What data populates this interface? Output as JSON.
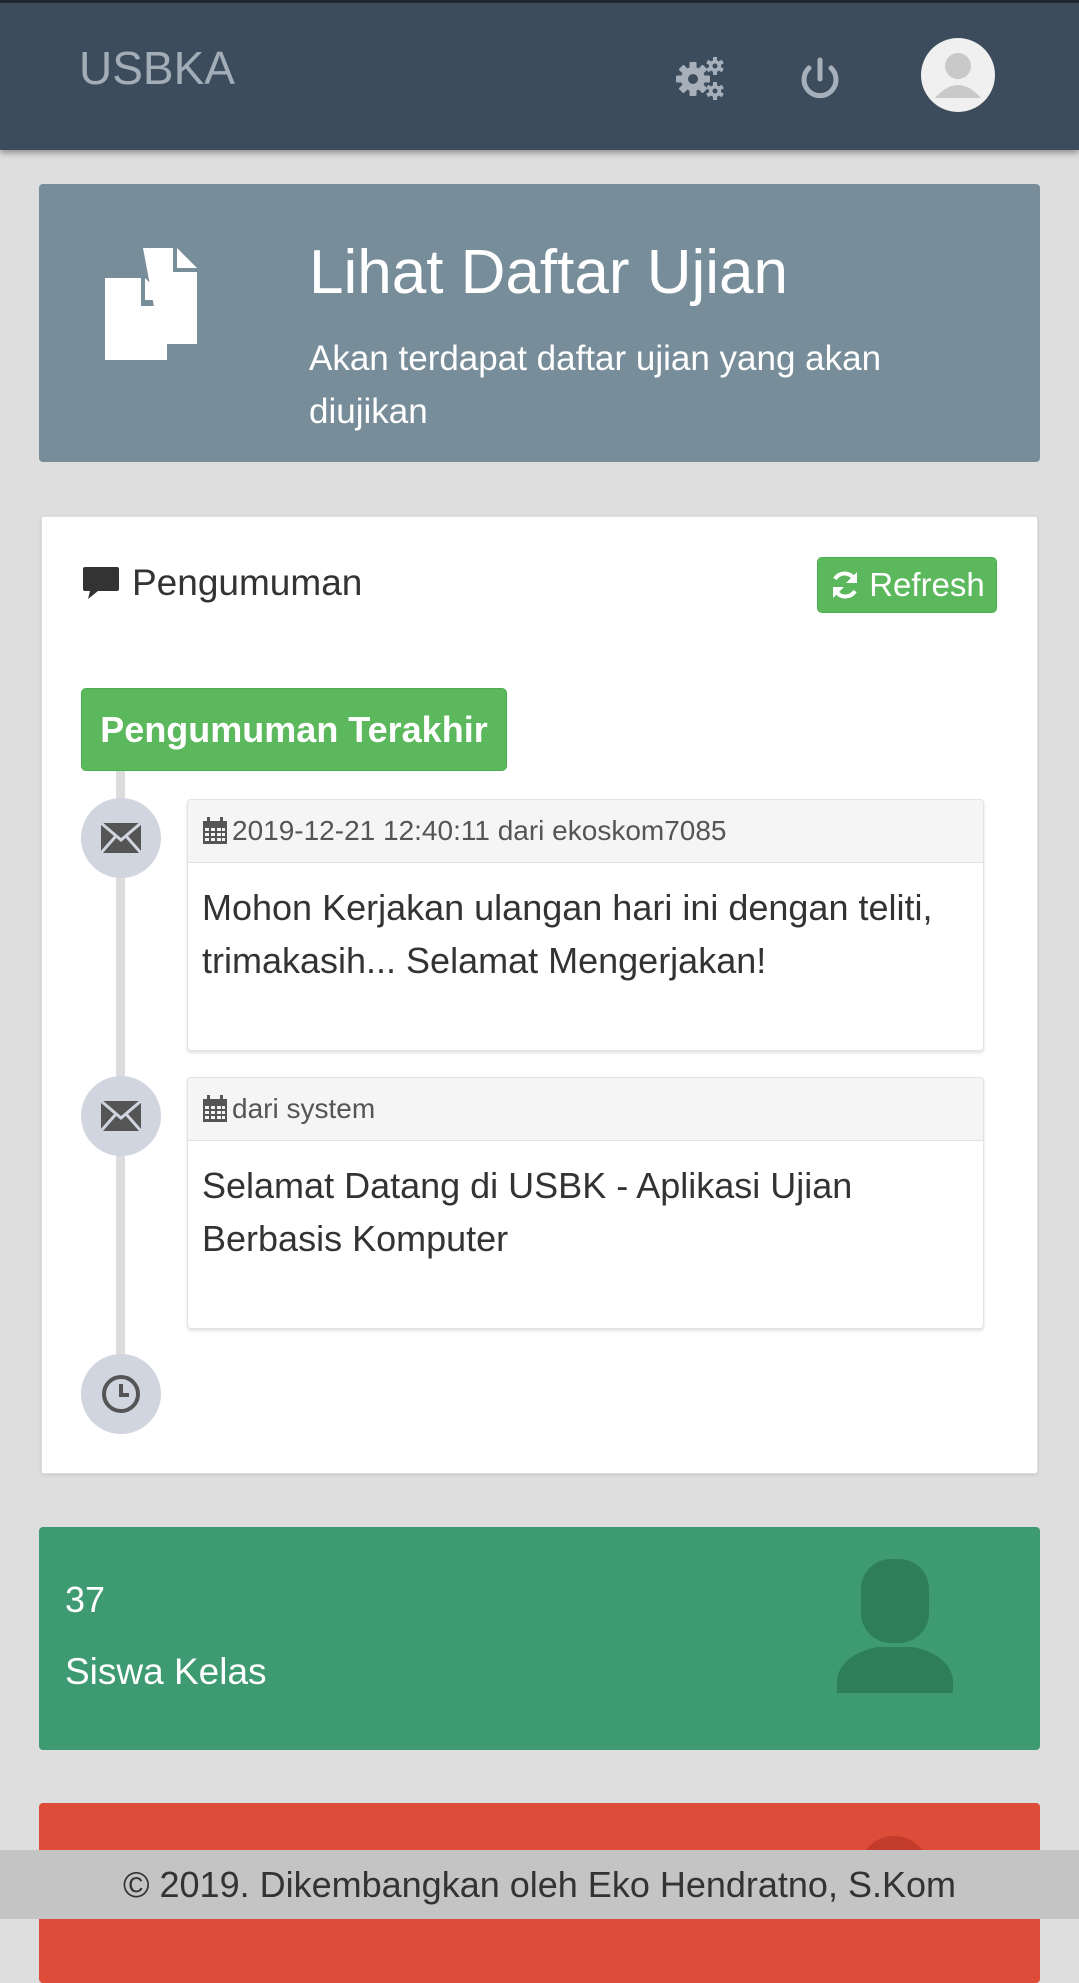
{
  "navbar": {
    "brand": "USBKA",
    "icons": {
      "settings": "gears-icon",
      "logout": "power-icon",
      "profile": "avatar-icon"
    }
  },
  "hero": {
    "icon": "files-icon",
    "title": "Lihat Daftar Ujian",
    "subtitle": "Akan terdapat daftar ujian yang akan diujikan"
  },
  "announcements": {
    "title": "Pengumuman",
    "refresh_label": "Refresh",
    "timeline_label": "Pengumuman Terakhir",
    "items": [
      {
        "icon": "envelope-icon",
        "meta": "2019-12-21 12:40:11 dari ekoskom7085",
        "body": "Mohon Kerjakan ulangan hari ini dengan teliti, trimakasih... Selamat Mengerjakan!"
      },
      {
        "icon": "envelope-icon",
        "meta": " dari system",
        "body": "Selamat Datang di USBK - Aplikasi Ujian Berbasis Komputer"
      }
    ],
    "end_icon": "clock-icon"
  },
  "stats": {
    "students": {
      "value": "37",
      "label": "Siswa Kelas",
      "icon": "user-icon"
    }
  },
  "colors": {
    "navbar": "#3d4c5c",
    "hero": "#788d9a",
    "success": "#5cb85c",
    "stat_green": "#3e9a71",
    "stat_red": "#dd4b39"
  },
  "footer": {
    "text": "© 2019. Dikembangkan oleh Eko Hendratno, S.Kom"
  }
}
